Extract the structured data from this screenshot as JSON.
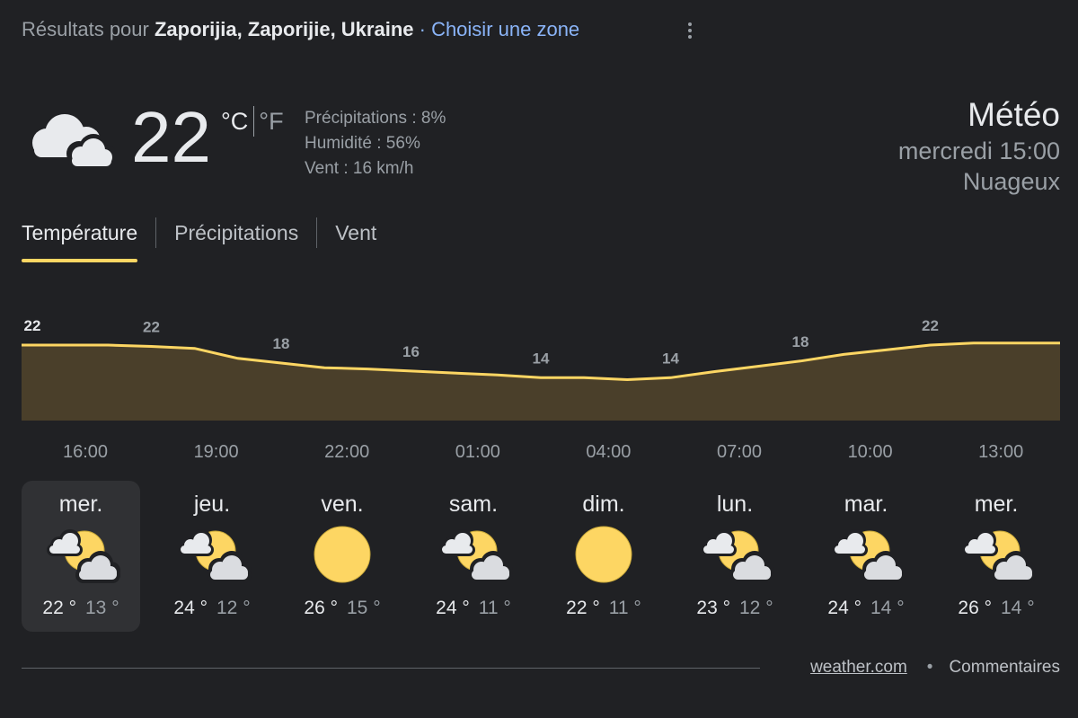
{
  "header": {
    "prefix": "Résultats pour ",
    "location": "Zaporijia, Zaporijie, Ukraine",
    "separator": " · ",
    "choose_zone": "Choisir une zone"
  },
  "current": {
    "temp": "22",
    "unit_c": "°C",
    "unit_f": "°F",
    "precip": "Précipitations : 8%",
    "humidity": "Humidité : 56%",
    "wind": "Vent : 16 km/h",
    "icon": "cloudy-icon"
  },
  "summary": {
    "title": "Météo",
    "when": "mercredi 15:00",
    "condition": "Nuageux"
  },
  "tabs": [
    {
      "label": "Température",
      "active": true
    },
    {
      "label": "Précipitations",
      "active": false
    },
    {
      "label": "Vent",
      "active": false
    }
  ],
  "chart_data": {
    "type": "area",
    "x": [
      "15:00",
      "16:00",
      "17:00",
      "18:00",
      "19:00",
      "20:00",
      "21:00",
      "22:00",
      "23:00",
      "00:00",
      "01:00",
      "02:00",
      "03:00",
      "04:00",
      "05:00",
      "06:00",
      "07:00",
      "08:00",
      "09:00",
      "10:00",
      "11:00",
      "12:00",
      "13:00",
      "14:00",
      "15:00"
    ],
    "values": [
      22,
      22,
      22,
      21.8,
      21.5,
      20,
      19.3,
      18.6,
      18.4,
      18.1,
      17.8,
      17.5,
      17.1,
      17.1,
      16.8,
      17.1,
      18,
      18.8,
      19.6,
      20.6,
      21.3,
      22,
      22.3,
      22.3,
      22.3
    ],
    "labels": [
      {
        "index": 0,
        "text": "22"
      },
      {
        "index": 3,
        "text": "22"
      },
      {
        "index": 6,
        "text": "18"
      },
      {
        "index": 9,
        "text": "16"
      },
      {
        "index": 12,
        "text": "14"
      },
      {
        "index": 15,
        "text": "14"
      },
      {
        "index": 18,
        "text": "18"
      },
      {
        "index": 21,
        "text": "22"
      }
    ],
    "tick_labels": [
      "16:00",
      "19:00",
      "22:00",
      "01:00",
      "04:00",
      "07:00",
      "10:00",
      "13:00"
    ],
    "line_color": "#fdd663",
    "fill_color": "#4a3f2a"
  },
  "days": [
    {
      "name": "mer.",
      "hi": "22 °",
      "lo": "13 °",
      "icon": "partly-cloudy-icon",
      "selected": true
    },
    {
      "name": "jeu.",
      "hi": "24 °",
      "lo": "12 °",
      "icon": "partly-cloudy-icon",
      "selected": false
    },
    {
      "name": "ven.",
      "hi": "26 °",
      "lo": "15 °",
      "icon": "sunny-icon",
      "selected": false
    },
    {
      "name": "sam.",
      "hi": "24 °",
      "lo": "11 °",
      "icon": "partly-cloudy-icon",
      "selected": false
    },
    {
      "name": "dim.",
      "hi": "22 °",
      "lo": "11 °",
      "icon": "sunny-icon",
      "selected": false
    },
    {
      "name": "lun.",
      "hi": "23 °",
      "lo": "12 °",
      "icon": "partly-cloudy-icon",
      "selected": false
    },
    {
      "name": "mar.",
      "hi": "24 °",
      "lo": "14 °",
      "icon": "partly-cloudy-icon",
      "selected": false
    },
    {
      "name": "mer.",
      "hi": "26 °",
      "lo": "14 °",
      "icon": "partly-cloudy-icon",
      "selected": false
    }
  ],
  "footer": {
    "source": "weather.com",
    "dot": "•",
    "feedback": "Commentaires"
  }
}
